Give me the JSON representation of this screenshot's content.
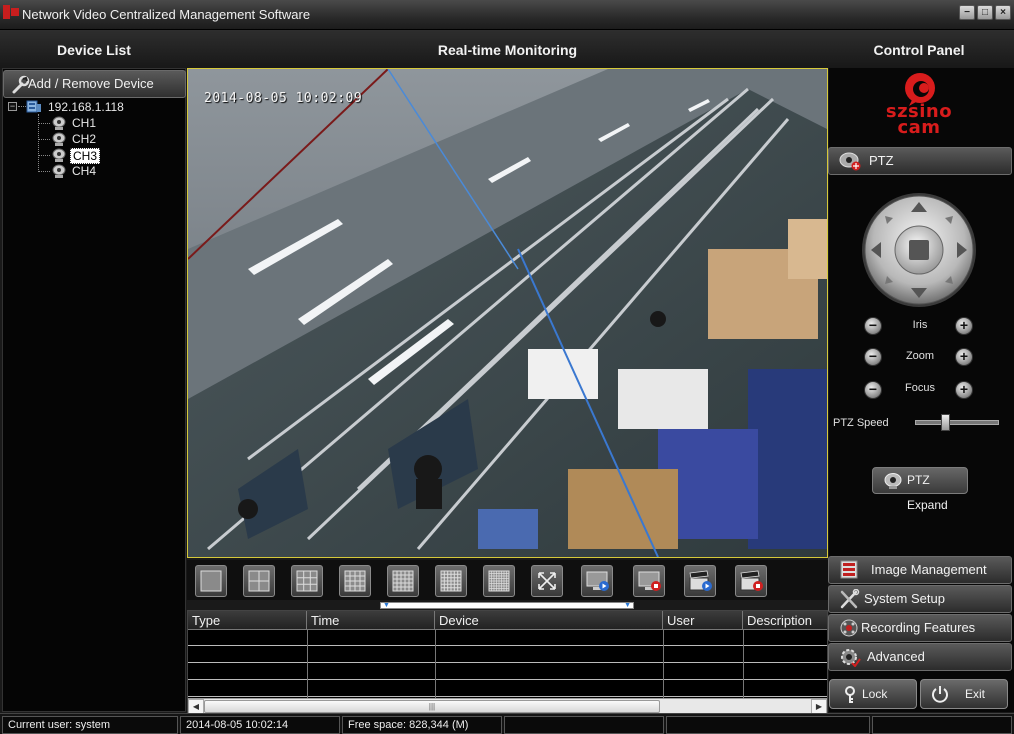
{
  "window": {
    "title": "Network Video Centralized Management Software",
    "buttons": {
      "minimize": "−",
      "maximize": "□",
      "close": "×"
    }
  },
  "headers": {
    "device_list": "Device List",
    "monitoring": "Real-time Monitoring",
    "control_panel": "Control Panel"
  },
  "device_panel": {
    "add_remove_label": "Add / Remove Device",
    "device": {
      "address": "192.168.1.118",
      "expander": "−"
    },
    "channels": [
      {
        "label": "CH1",
        "selected": false
      },
      {
        "label": "CH2",
        "selected": false
      },
      {
        "label": "CH3",
        "selected": true
      },
      {
        "label": "CH4",
        "selected": false
      }
    ]
  },
  "video": {
    "timestamp": "2014-08-05 10:02:09"
  },
  "layout_buttons": [
    {
      "name": "single-view-button",
      "icon": "layout-1-icon"
    },
    {
      "name": "quad-view-button",
      "icon": "layout-4-icon"
    },
    {
      "name": "nine-view-button",
      "icon": "layout-9-icon"
    },
    {
      "name": "sixteen-view-button",
      "icon": "layout-16-icon"
    },
    {
      "name": "twentyfive-view-button",
      "icon": "layout-25-icon"
    },
    {
      "name": "thirtysix-view-button",
      "icon": "layout-36-icon"
    },
    {
      "name": "sixtyfour-view-button",
      "icon": "layout-64-icon"
    },
    {
      "name": "fullscreen-button",
      "icon": "fullscreen-icon"
    },
    {
      "name": "start-all-preview-button",
      "icon": "monitor-play-icon"
    },
    {
      "name": "stop-all-preview-button",
      "icon": "monitor-stop-icon"
    },
    {
      "name": "start-all-record-button",
      "icon": "clapper-play-icon"
    },
    {
      "name": "stop-all-record-button",
      "icon": "clapper-stop-icon"
    }
  ],
  "log_table": {
    "columns": [
      "Type",
      "Time",
      "Device",
      "User",
      "Description"
    ],
    "rows": [],
    "scroll_thumb": "|||"
  },
  "logo": {
    "line1": "szsino",
    "line2": "cam",
    "color": "#d81c1c"
  },
  "control_panel": {
    "ptz_label": "PTZ",
    "iris_label": "Iris",
    "zoom_label": "Zoom",
    "focus_label": "Focus",
    "minus": "−",
    "plus": "+",
    "speed_label": "PTZ Speed",
    "speed_value": 0.35,
    "expand_label": "PTZ Expand"
  },
  "menu": {
    "image_management": "Image Management",
    "system_setup": "System Setup",
    "recording_features": "Recording Features",
    "advanced": "Advanced"
  },
  "actions": {
    "lock": "Lock",
    "exit": "Exit"
  },
  "status": {
    "user": "Current user: system",
    "time": "2014-08-05 10:02:14",
    "free_space": "Free space: 828,344 (M)"
  }
}
